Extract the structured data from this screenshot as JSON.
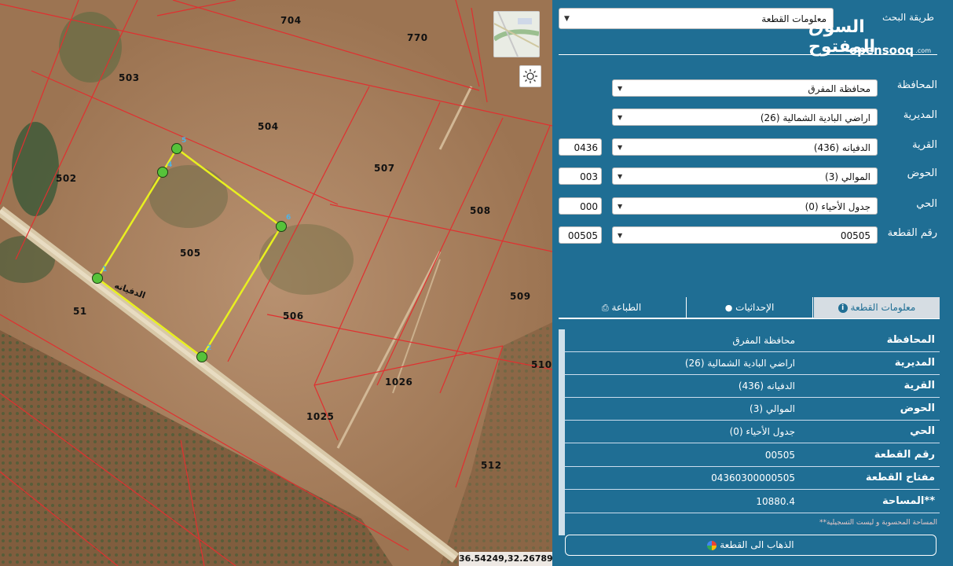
{
  "map": {
    "parcels": [
      "704",
      "770",
      "503",
      "504",
      "502",
      "507",
      "508",
      "505",
      "51",
      "506",
      "509",
      "510",
      "1026",
      "1025",
      "512"
    ],
    "road_label": "الدفيانه",
    "vertex_markers": [
      "1",
      "2",
      "3",
      "4",
      "5",
      "6"
    ],
    "coordinates": "36.54249,32.26789",
    "colors": {
      "boundary": "#e03030",
      "selected": "#e8f020",
      "vertex": "#56c23a"
    }
  },
  "panel": {
    "search_method_label": "طريقة البحث",
    "search_method_value": "معلومات القطعة",
    "logo_arabic": "السوق المفتوح",
    "logo_latin": "opensooq",
    "logo_suffix": ".com",
    "form": {
      "governorate_label": "المحافظة",
      "governorate_value": "محافظة المفرق",
      "directorate_label": "المديرية",
      "directorate_value": "اراضي البادية الشمالية (26)",
      "village_label": "القرية",
      "village_value": "الدفيانه (436)",
      "village_code": "0436",
      "basin_label": "الحوض",
      "basin_value": "الموالي (3)",
      "basin_code": "003",
      "district_label": "الحي",
      "district_value": "جدول الأحياء (0)",
      "district_code": "000",
      "plot_label": "رقم القطعة",
      "plot_value": "00505",
      "plot_code": "00505"
    },
    "tabs": {
      "info": "معلومات القطعة",
      "coords": "الإحداثيات",
      "print": "الطباعة"
    },
    "info": [
      {
        "key": "المحافظة",
        "value": "محافظة المفرق"
      },
      {
        "key": "المديرية",
        "value": "اراضي البادية الشمالية (26)"
      },
      {
        "key": "القرية",
        "value": "الدفيانه (436)"
      },
      {
        "key": "الحوض",
        "value": "الموالي (3)"
      },
      {
        "key": "الحي",
        "value": "جدول الأحياء (0)"
      },
      {
        "key": "رقم القطعة",
        "value": "00505"
      },
      {
        "key": "مفتاح القطعة",
        "value": "04360300000505"
      },
      {
        "key": "المساحة**",
        "value": "10880.4"
      }
    ],
    "footnote": "**المساحة المحسوبة و ليست التسجيلية",
    "goto_button": "الذهاب الى القطعة"
  }
}
